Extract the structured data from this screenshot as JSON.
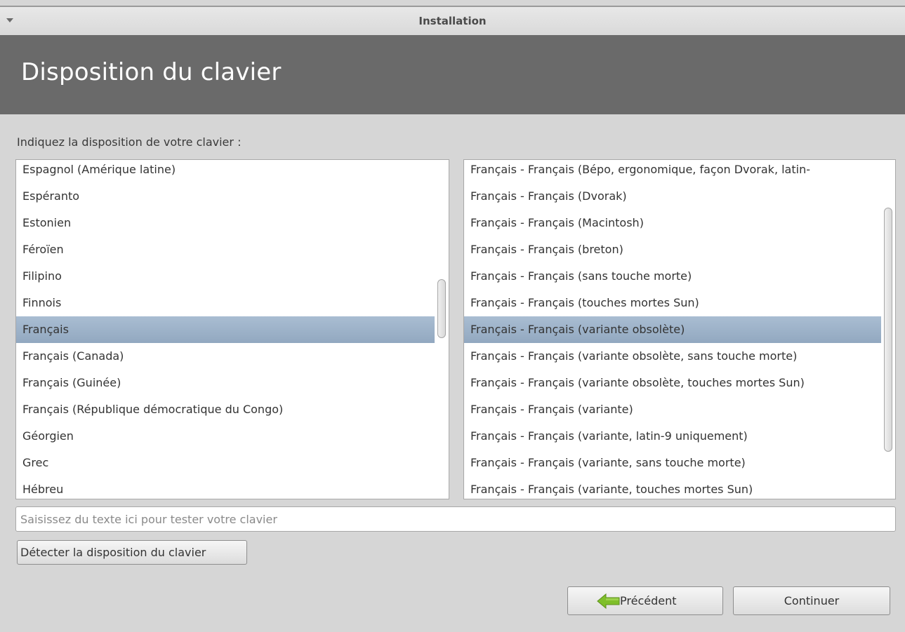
{
  "window": {
    "title": "Installation"
  },
  "header": {
    "title": "Disposition du clavier"
  },
  "prompt": "Indiquez la disposition de votre clavier :",
  "layouts": {
    "items": [
      "Espagnol (Amérique latine)",
      "Espéranto",
      "Estonien",
      "Féroïen",
      "Filipino",
      "Finnois",
      "Français",
      "Français (Canada)",
      "Français (Guinée)",
      "Français (République démocratique du Congo)",
      "Géorgien",
      "Grec",
      "Hébreu"
    ],
    "selected_index": 6
  },
  "variants": {
    "items": [
      "Français - Français (Bépo, ergonomique, façon Dvorak, latin-",
      "Français - Français (Dvorak)",
      "Français - Français (Macintosh)",
      "Français - Français (breton)",
      "Français - Français (sans touche morte)",
      "Français - Français (touches mortes Sun)",
      "Français - Français (variante obsolète)",
      "Français - Français (variante obsolète, sans touche morte)",
      "Français - Français (variante obsolète, touches mortes Sun)",
      "Français - Français (variante)",
      "Français - Français (variante, latin-9 uniquement)",
      "Français - Français (variante, sans touche morte)",
      "Français - Français (variante, touches mortes Sun)"
    ],
    "selected_index": 6
  },
  "test_input": {
    "placeholder": "Saisissez du texte ici pour tester votre clavier",
    "value": ""
  },
  "buttons": {
    "detect": "Détecter la disposition du clavier",
    "back": "Précédent",
    "continue": "Continuer"
  },
  "icons": {
    "back": "back-arrow-icon",
    "window_menu": "window-menu-arrow-icon"
  },
  "colors": {
    "header_bg": "#6a6a6a",
    "selection": "#9eb3ca",
    "back_arrow": "#7fbf2a"
  }
}
